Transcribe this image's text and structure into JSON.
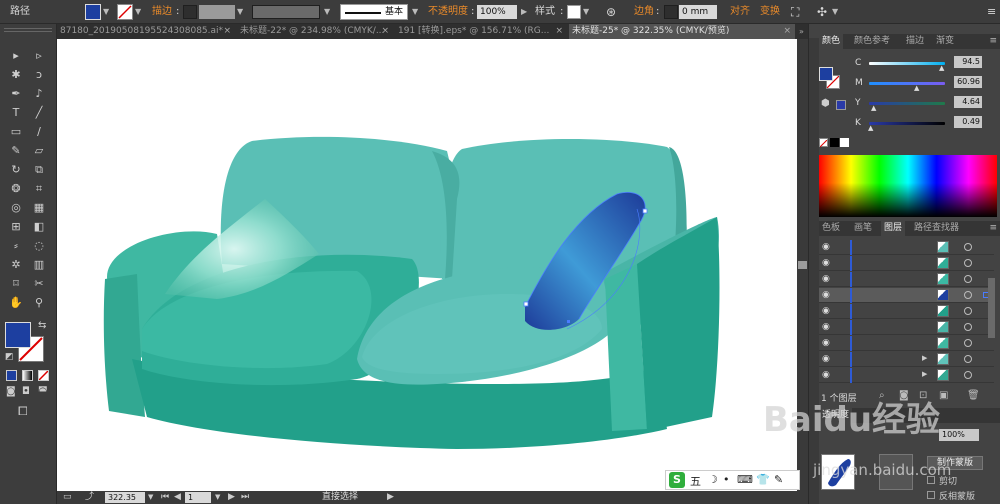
{
  "control_bar": {
    "object_type": "路径",
    "stroke_label": "描边",
    "stroke_profile": "基本",
    "opacity_label": "不透明度",
    "opacity_value": "100%",
    "style_label": "样式",
    "corner_label": "边角",
    "corner_value": "0 mm",
    "align_label": "对齐",
    "transform_label": "变换",
    "fill_color": "#1d3fa0",
    "accent_color": "#e98a2a"
  },
  "tabs": [
    {
      "label": "87180_20190508195524308085.ai*",
      "active": false
    },
    {
      "label": "未标题-22* @ 234.98% (CMYK/...",
      "active": false
    },
    {
      "label": "191 [转换].eps* @ 156.71% (RG...",
      "active": false
    },
    {
      "label": "未标题-25* @ 322.35% (CMYK/预览)",
      "active": true
    }
  ],
  "tools": [
    {
      "icon": "selection-tool-icon",
      "glyph": "▸"
    },
    {
      "icon": "direct-selection-tool-icon",
      "glyph": "▹"
    },
    {
      "icon": "magic-wand-tool-icon",
      "glyph": "✱"
    },
    {
      "icon": "lasso-tool-icon",
      "glyph": "ↄ"
    },
    {
      "icon": "pen-tool-icon",
      "glyph": "✒"
    },
    {
      "icon": "curvature-tool-icon",
      "glyph": "♪"
    },
    {
      "icon": "type-tool-icon",
      "glyph": "T"
    },
    {
      "icon": "line-tool-icon",
      "glyph": "╱"
    },
    {
      "icon": "rectangle-tool-icon",
      "glyph": "▭"
    },
    {
      "icon": "paintbrush-tool-icon",
      "glyph": "∕"
    },
    {
      "icon": "pencil-tool-icon",
      "glyph": "✎"
    },
    {
      "icon": "eraser-tool-icon",
      "glyph": "▱"
    },
    {
      "icon": "rotate-tool-icon",
      "glyph": "↻"
    },
    {
      "icon": "scale-tool-icon",
      "glyph": "⧉"
    },
    {
      "icon": "warp-tool-icon",
      "glyph": "❂"
    },
    {
      "icon": "free-transform-tool-icon",
      "glyph": "⌗"
    },
    {
      "icon": "shape-builder-tool-icon",
      "glyph": "◎"
    },
    {
      "icon": "perspective-grid-tool-icon",
      "glyph": "▦"
    },
    {
      "icon": "mesh-tool-icon",
      "glyph": "⊞"
    },
    {
      "icon": "gradient-tool-icon",
      "glyph": "◧"
    },
    {
      "icon": "eyedropper-tool-icon",
      "glyph": "⸗"
    },
    {
      "icon": "blend-tool-icon",
      "glyph": "◌"
    },
    {
      "icon": "symbol-sprayer-tool-icon",
      "glyph": "✲"
    },
    {
      "icon": "column-graph-tool-icon",
      "glyph": "▥"
    },
    {
      "icon": "artboard-tool-icon",
      "glyph": "⌑"
    },
    {
      "icon": "slice-tool-icon",
      "glyph": "✂"
    },
    {
      "icon": "hand-tool-icon",
      "glyph": "✋"
    },
    {
      "icon": "zoom-tool-icon",
      "glyph": "⚲"
    }
  ],
  "color_panel": {
    "tabs": [
      "颜色",
      "颜色参考",
      "描边",
      "渐变"
    ],
    "channels": [
      {
        "name": "C",
        "value": "94.5"
      },
      {
        "name": "M",
        "value": "60.96"
      },
      {
        "name": "Y",
        "value": "4.64"
      },
      {
        "name": "K",
        "value": "0.49"
      }
    ]
  },
  "layers_panel": {
    "tabs": [
      "色板",
      "画笔",
      "图层",
      "路径查找器"
    ],
    "footer_label": "1 个图层",
    "rows": 9,
    "selected_row": 3
  },
  "opacity_panel": {
    "label": "透明度",
    "value": "100%",
    "make_mask_button": "制作蒙版",
    "clip_label": "剪切",
    "invert_label": "反相蒙版"
  },
  "status_bar": {
    "zoom": "322.35",
    "page": "1",
    "tool_name": "直接选择"
  },
  "ime_bar": {
    "badge": "S",
    "mode": "五"
  },
  "watermark": {
    "brand": "Baidu经验",
    "url": "jingyan.baidu.com"
  }
}
